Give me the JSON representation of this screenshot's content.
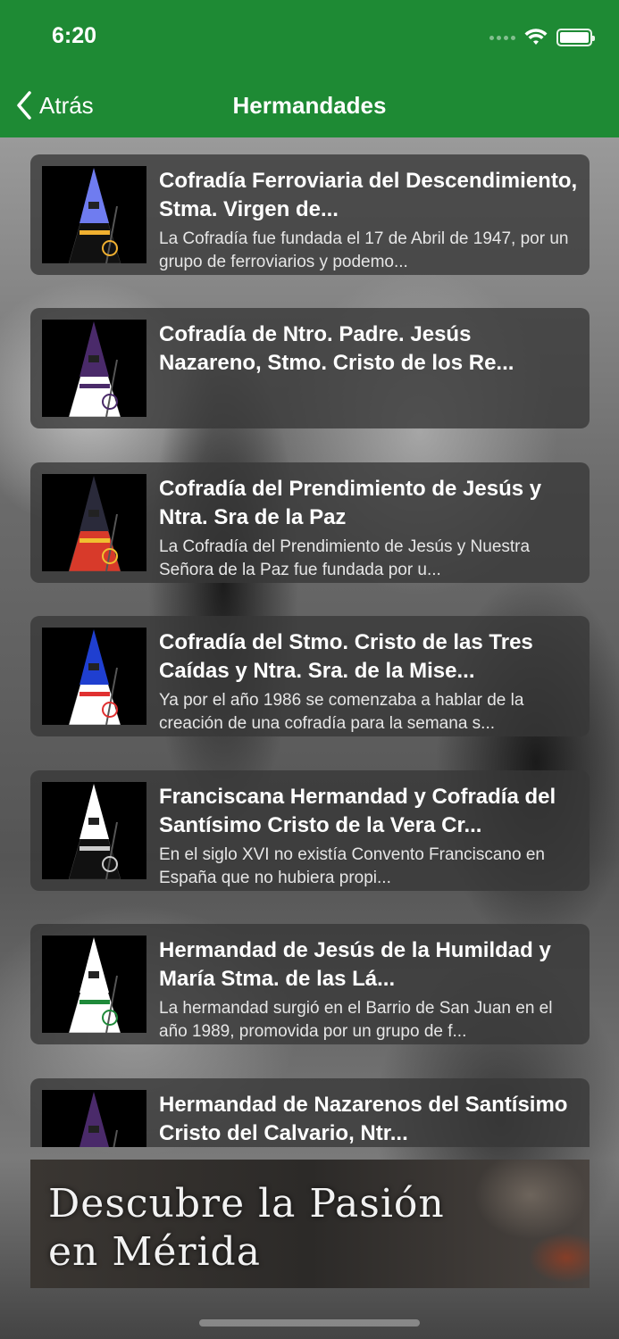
{
  "status_bar": {
    "time": "6:20"
  },
  "nav": {
    "back_label": "Atrás",
    "title": "Hermandades"
  },
  "items": [
    {
      "title": "Cofradía Ferroviaria del Descendimiento, Stma. Virgen de...",
      "description": "La Cofradía fue fundada el 17 de Abril de 1947, por un grupo de ferroviarios y podemo...",
      "hood_color": "#6f7cf0",
      "robe_color": "#000000",
      "accent": "#f0b030"
    },
    {
      "title": "Cofradía de Ntro. Padre. Jesús Nazareno, Stmo. Cristo de los Re...",
      "description": "",
      "hood_color": "#4a2a6a",
      "robe_color": "#ffffff",
      "accent": "#4a2a6a"
    },
    {
      "title": "Cofradía del Prendimiento de Jesús y Ntra. Sra de la Paz",
      "description": "La Cofradía del Prendimiento de Jesús y Nuestra Señora de la Paz fue fundada por u...",
      "hood_color": "#2a2a3a",
      "robe_color": "#d83a2a",
      "accent": "#f0c030"
    },
    {
      "title": "Cofradía del Stmo. Cristo de las Tres Caídas y Ntra. Sra. de la Mise...",
      "description": "Ya por el año 1986 se comenzaba a hablar de la creación de una cofradía para la semana s...",
      "hood_color": "#1f3fd0",
      "robe_color": "#ffffff",
      "accent": "#e03030"
    },
    {
      "title": "Franciscana Hermandad y Cofradía del Santísimo Cristo de la Vera Cr...",
      "description": "En el siglo XVI no existía Convento Franciscano en España que no hubiera propi...",
      "hood_color": "#ffffff",
      "robe_color": "#111111",
      "accent": "#cccccc"
    },
    {
      "title": "Hermandad de Jesús de la Humildad y María Stma. de las Lá...",
      "description": "La hermandad surgió en el Barrio de San Juan en el año 1989, promovida por un grupo de f...",
      "hood_color": "#ffffff",
      "robe_color": "#ffffff",
      "accent": "#1f8a3a"
    },
    {
      "title": "Hermandad de Nazarenos del Santísimo Cristo del Calvario, Ntr...",
      "description": "",
      "hood_color": "#4a2a6a",
      "robe_color": "#ffffff",
      "accent": "#4a2a6a"
    }
  ],
  "banner": {
    "line1": "Descubre la Pasión",
    "line2": "en Mérida"
  },
  "colors": {
    "header_green": "#1e8a34"
  }
}
